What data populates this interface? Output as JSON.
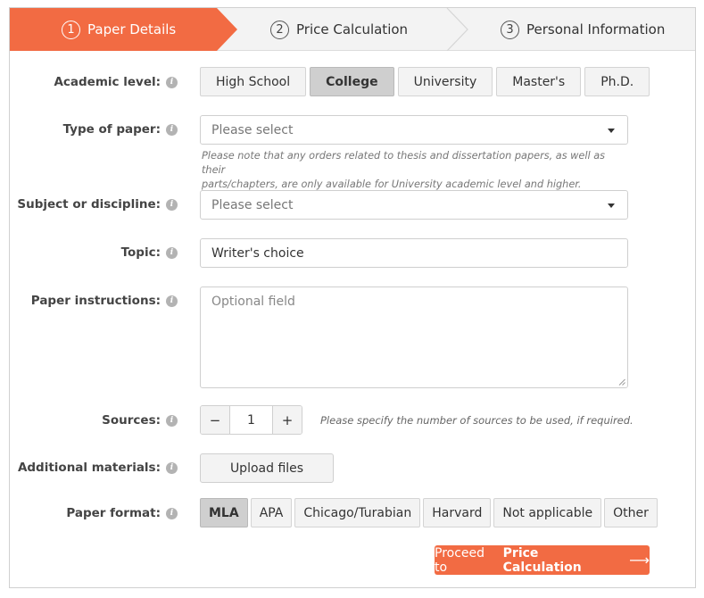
{
  "steps": [
    {
      "num": "1",
      "label": "Paper Details"
    },
    {
      "num": "2",
      "label": "Price Calculation"
    },
    {
      "num": "3",
      "label": "Personal Information"
    }
  ],
  "academic_level": {
    "label": "Academic level:",
    "options": [
      "High School",
      "College",
      "University",
      "Master's",
      "Ph.D."
    ],
    "selected": "College"
  },
  "type_of_paper": {
    "label": "Type of paper:",
    "placeholder": "Please select",
    "note_line1": "Please note that any orders related to thesis and dissertation papers, as well as their",
    "note_line2": "parts/chapters, are only available for University academic level and higher."
  },
  "subject": {
    "label": "Subject or discipline:",
    "placeholder": "Please select"
  },
  "topic": {
    "label": "Topic:",
    "value": "Writer's choice"
  },
  "instructions": {
    "label": "Paper instructions:",
    "placeholder": "Optional field"
  },
  "sources": {
    "label": "Sources:",
    "minus": "−",
    "value": "1",
    "plus": "+",
    "note": "Please specify the number of sources to be used, if required."
  },
  "materials": {
    "label": "Additional materials:",
    "button": "Upload files"
  },
  "paper_format": {
    "label": "Paper format:",
    "options": [
      "MLA",
      "APA",
      "Chicago/Turabian",
      "Harvard",
      "Not applicable",
      "Other"
    ],
    "selected": "MLA"
  },
  "proceed": {
    "prefix": "Proceed to",
    "strong": "Price Calculation",
    "arrow": "⟶"
  },
  "colors": {
    "accent": "#f26b43",
    "selected_segment": "#cfcfcf"
  }
}
